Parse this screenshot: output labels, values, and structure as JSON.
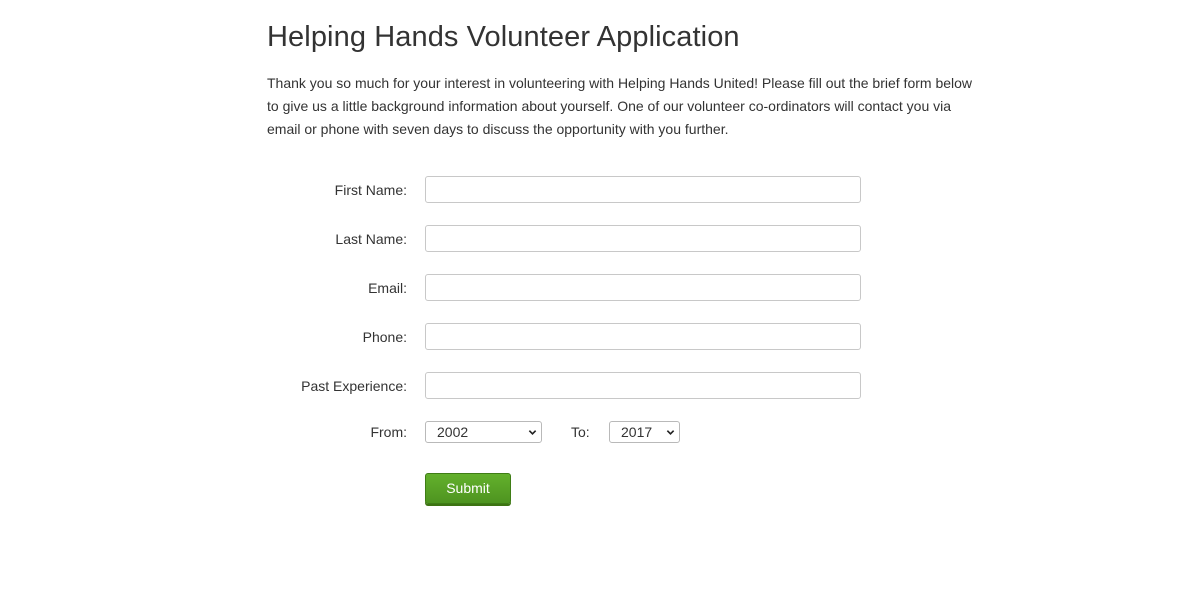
{
  "page": {
    "title": "Helping Hands Volunteer Application",
    "intro": "Thank you so much for your interest in volunteering with Helping Hands United! Please fill out the brief form below to give us a little background information about yourself. One of our volunteer co-ordinators will contact you via email or phone with seven days to discuss the opportunity with you further."
  },
  "form": {
    "first_name": {
      "label": "First Name:",
      "value": ""
    },
    "last_name": {
      "label": "Last Name:",
      "value": ""
    },
    "email": {
      "label": "Email:",
      "value": ""
    },
    "phone": {
      "label": "Phone:",
      "value": ""
    },
    "past_experience": {
      "label": "Past Experience:",
      "value": ""
    },
    "from": {
      "label": "From:",
      "selected": "2002"
    },
    "to": {
      "label": "To:",
      "selected": "2017"
    },
    "submit_label": "Submit"
  },
  "colors": {
    "text": "#333333",
    "submit_green": "#58a226",
    "input_border": "#c8c8c8"
  },
  "icons": {
    "select_arrow": "chevron-down-icon"
  }
}
